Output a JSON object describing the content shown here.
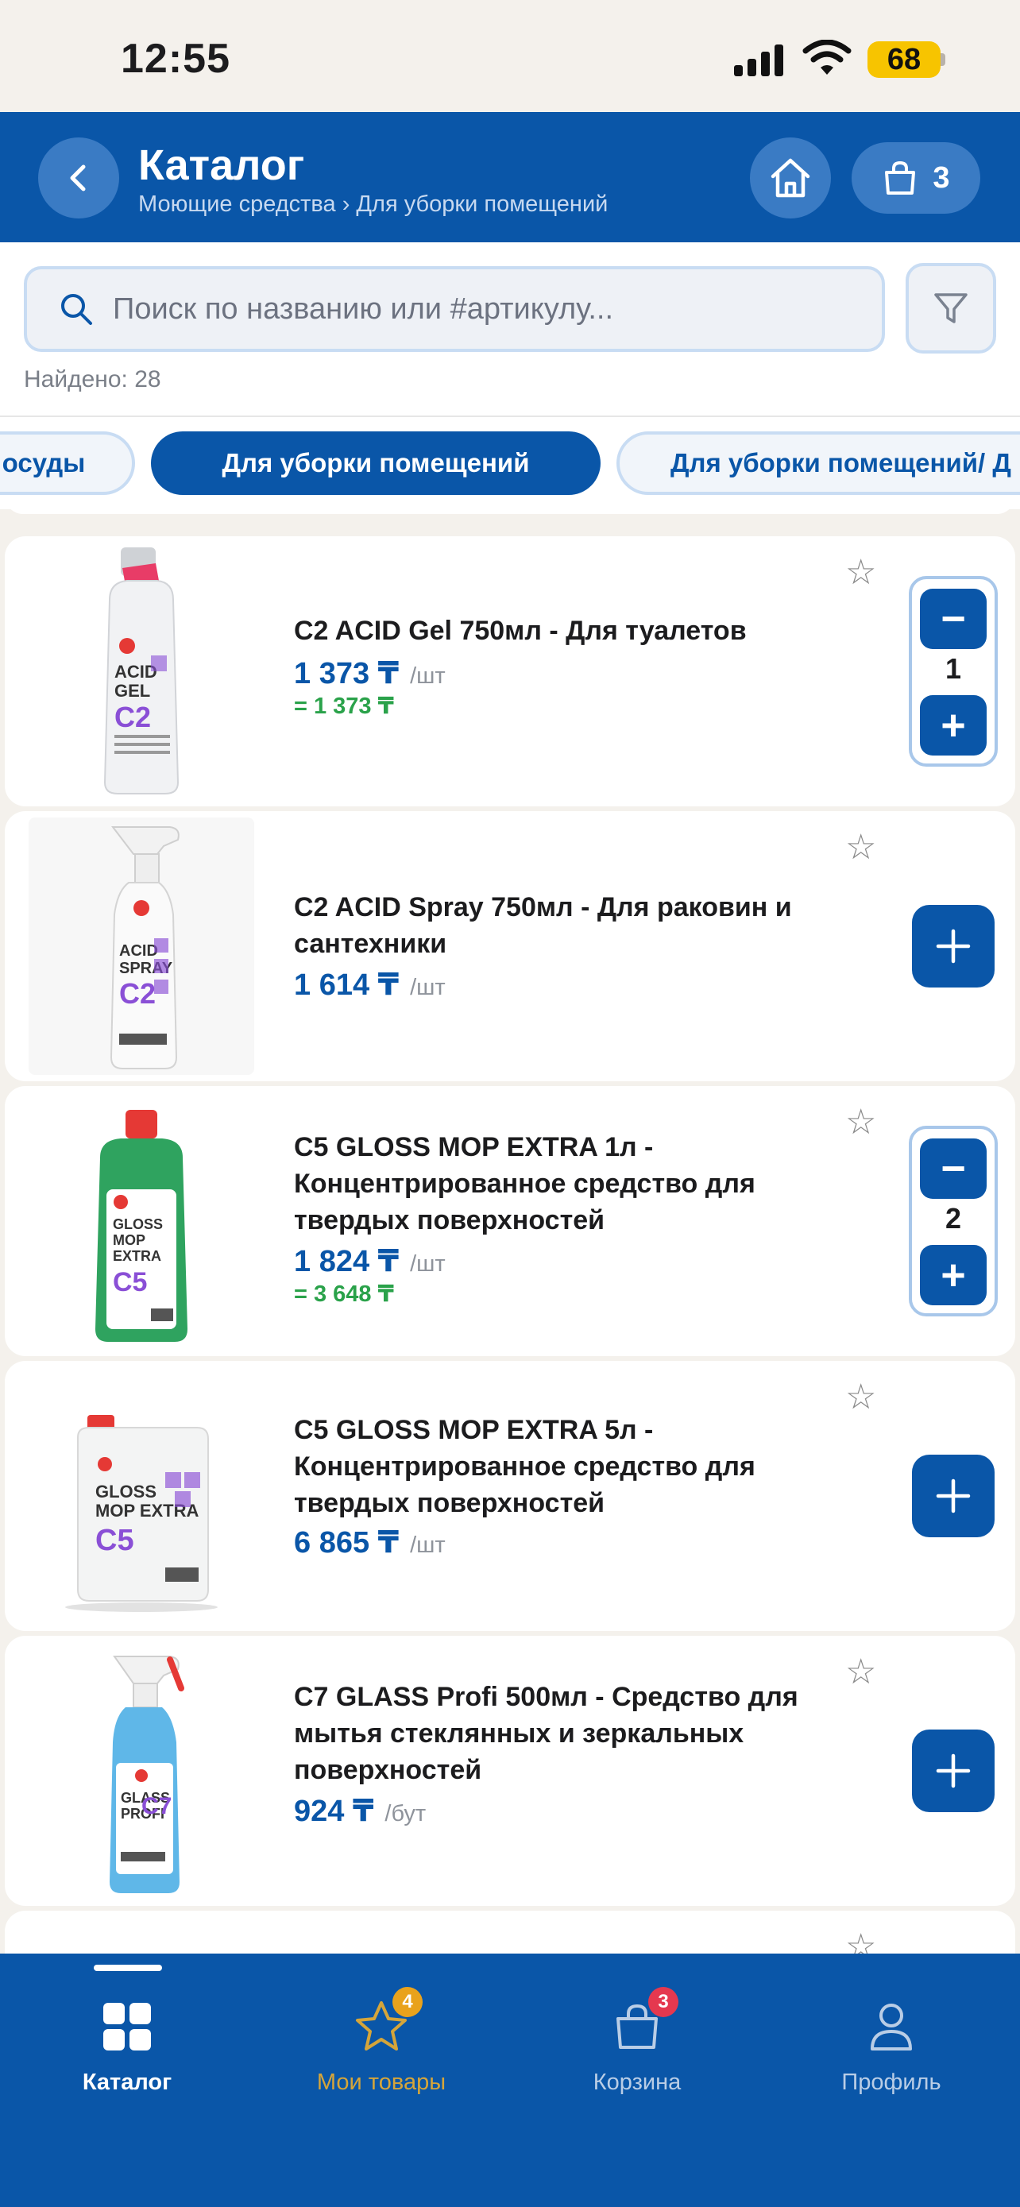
{
  "status_bar": {
    "time": "12:55",
    "battery": "68"
  },
  "header": {
    "title": "Каталог",
    "breadcrumb": "Моющие средства › Для уборки помещений",
    "cart_count": "3"
  },
  "search": {
    "placeholder": "Поиск по названию или #артикулу...",
    "value": "",
    "found_text": "Найдено: 28"
  },
  "chips": [
    {
      "label": "осуды",
      "active": false
    },
    {
      "label": "Для уборки помещений",
      "active": true
    },
    {
      "label": "Для уборки помещений/ Д",
      "active": false
    }
  ],
  "products": [
    {
      "name": "C2 ACID Gel 750мл - Для туалетов",
      "price": "1 373 ₸",
      "unit": "/шт",
      "total": "= 1 373 ₸",
      "quantity": "1",
      "in_cart": true,
      "image_text": [
        "ACID",
        "GEL",
        "C2"
      ],
      "image_color": "#8a4fd6"
    },
    {
      "name": "C2 ACID Spray 750мл - Для раковин и сантехники",
      "price": "1 614 ₸",
      "unit": "/шт",
      "total": "",
      "quantity": "",
      "in_cart": false,
      "image_text": [
        "ACID",
        "SPRAY",
        "C2"
      ],
      "image_color": "#8a4fd6"
    },
    {
      "name": "C5 GLOSS MOP EXTRA 1л - Концентрированное средство для твердых поверхностей",
      "price": "1 824 ₸",
      "unit": "/шт",
      "total": "= 3 648 ₸",
      "quantity": "2",
      "in_cart": true,
      "image_text": [
        "GLOSS",
        "MOP",
        "EXTRA",
        "C5"
      ],
      "image_color": "#8a4fd6"
    },
    {
      "name": "C5 GLOSS MOP EXTRA 5л - Концентрированное средство для твердых поверхностей",
      "price": "6 865 ₸",
      "unit": "/шт",
      "total": "",
      "quantity": "",
      "in_cart": false,
      "image_text": [
        "GLOSS",
        "MOP EXTRA",
        "C5"
      ],
      "image_color": "#8a4fd6"
    },
    {
      "name": "C7 GLASS Profi 500мл - Средство для мытья стеклянных и зеркальных поверхностей",
      "price": "924 ₸",
      "unit": "/бут",
      "total": "",
      "quantity": "",
      "in_cart": false,
      "image_text": [
        "GLASS",
        "PROFI",
        "C7"
      ],
      "image_color": "#8a4fd6"
    }
  ],
  "stepper": {
    "minus": "−",
    "plus": "+"
  },
  "tabbar": {
    "tabs": [
      {
        "label": "Каталог",
        "icon": "grid-icon",
        "badge": ""
      },
      {
        "label": "Мои товары",
        "icon": "star-icon",
        "badge": "4"
      },
      {
        "label": "Корзина",
        "icon": "bag-icon",
        "badge": "3"
      },
      {
        "label": "Профиль",
        "icon": "person-icon",
        "badge": ""
      }
    ]
  },
  "colors": {
    "brand_blue": "#0a56a8",
    "price_blue": "#0a56a8",
    "total_green": "#2aa24a",
    "active_tab": "#ffffff",
    "favorites_tab": "#d5a53a",
    "inactive_tab": "#b9cde6",
    "favorites_badge": "#e9a21c",
    "cart_badge": "#e5384f"
  }
}
